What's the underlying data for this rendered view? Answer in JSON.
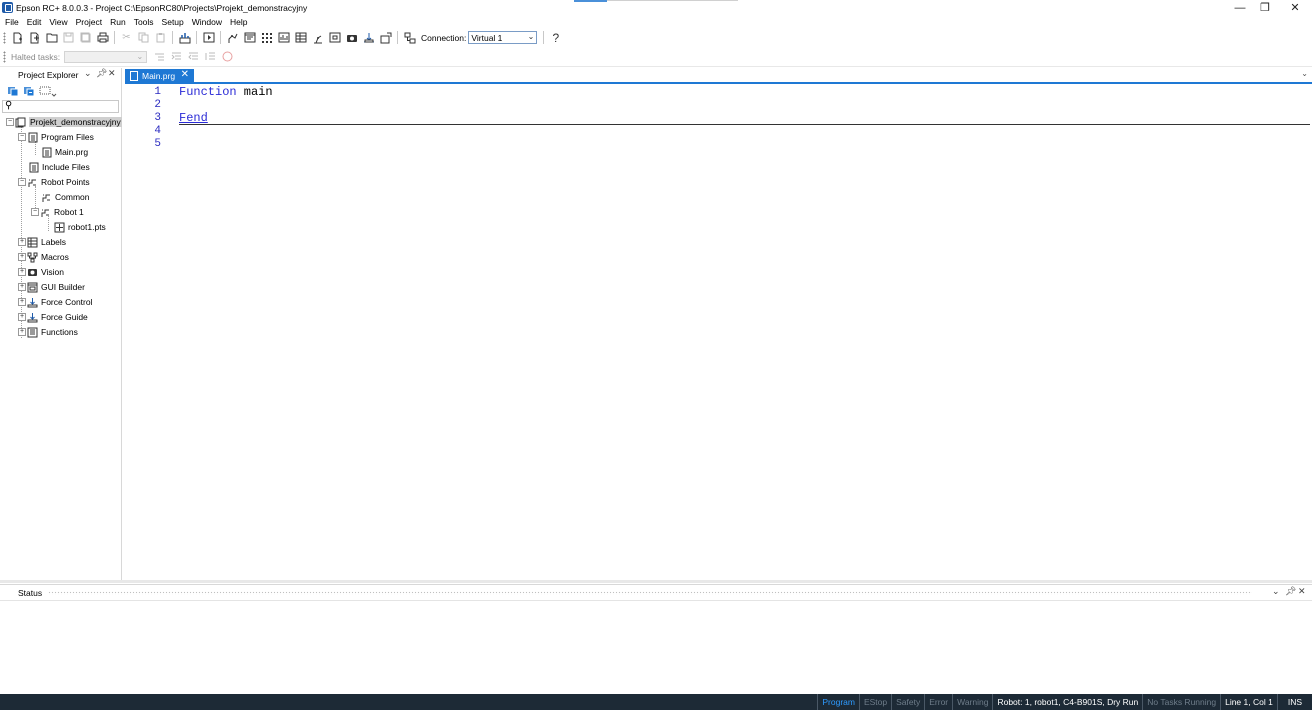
{
  "window": {
    "title": "Epson RC+ 8.0.0.3 - Project C:\\EpsonRC80\\Projects\\Projekt_demonstracyjny",
    "controls": {
      "minimize": "—",
      "restore": "❐",
      "close": "✕"
    }
  },
  "menu": [
    "File",
    "Edit",
    "View",
    "Project",
    "Run",
    "Tools",
    "Setup",
    "Window",
    "Help"
  ],
  "toolbar": {
    "connection_label": "Connection:",
    "connection_value": "Virtual 1",
    "help_label": "?",
    "halted_tasks_label": "Halted tasks:"
  },
  "explorer": {
    "title": "Project Explorer",
    "tree": {
      "root": "Projekt_demonstracyjny",
      "program_files": "Program Files",
      "main_prg": "Main.prg",
      "include_files": "Include Files",
      "robot_points": "Robot Points",
      "common": "Common",
      "robot1": "Robot 1",
      "robot1_pts": "robot1.pts",
      "labels": "Labels",
      "macros": "Macros",
      "vision": "Vision",
      "gui_builder": "GUI Builder",
      "force_control": "Force Control",
      "force_guide": "Force Guide",
      "functions": "Functions"
    }
  },
  "editor": {
    "tab_label": "Main.prg",
    "line_numbers": [
      "1",
      "2",
      "3",
      "4",
      "5"
    ],
    "line1_keyword": "Function",
    "line1_rest": " main",
    "line3_keyword": "Fend"
  },
  "status_pane": {
    "title": "Status"
  },
  "statusbar": {
    "program": "Program",
    "estop": "EStop",
    "safety": "Safety",
    "error": "Error",
    "warning": "Warning",
    "robot": "Robot: 1, robot1, C4-B901S, Dry Run",
    "tasks": "No Tasks Running",
    "position": "Line 1, Col 1",
    "mode": "INS"
  },
  "colors": {
    "accent": "#1e78d4",
    "keyword": "#2b2bd6",
    "statusbar_bg": "#1d2a36"
  }
}
